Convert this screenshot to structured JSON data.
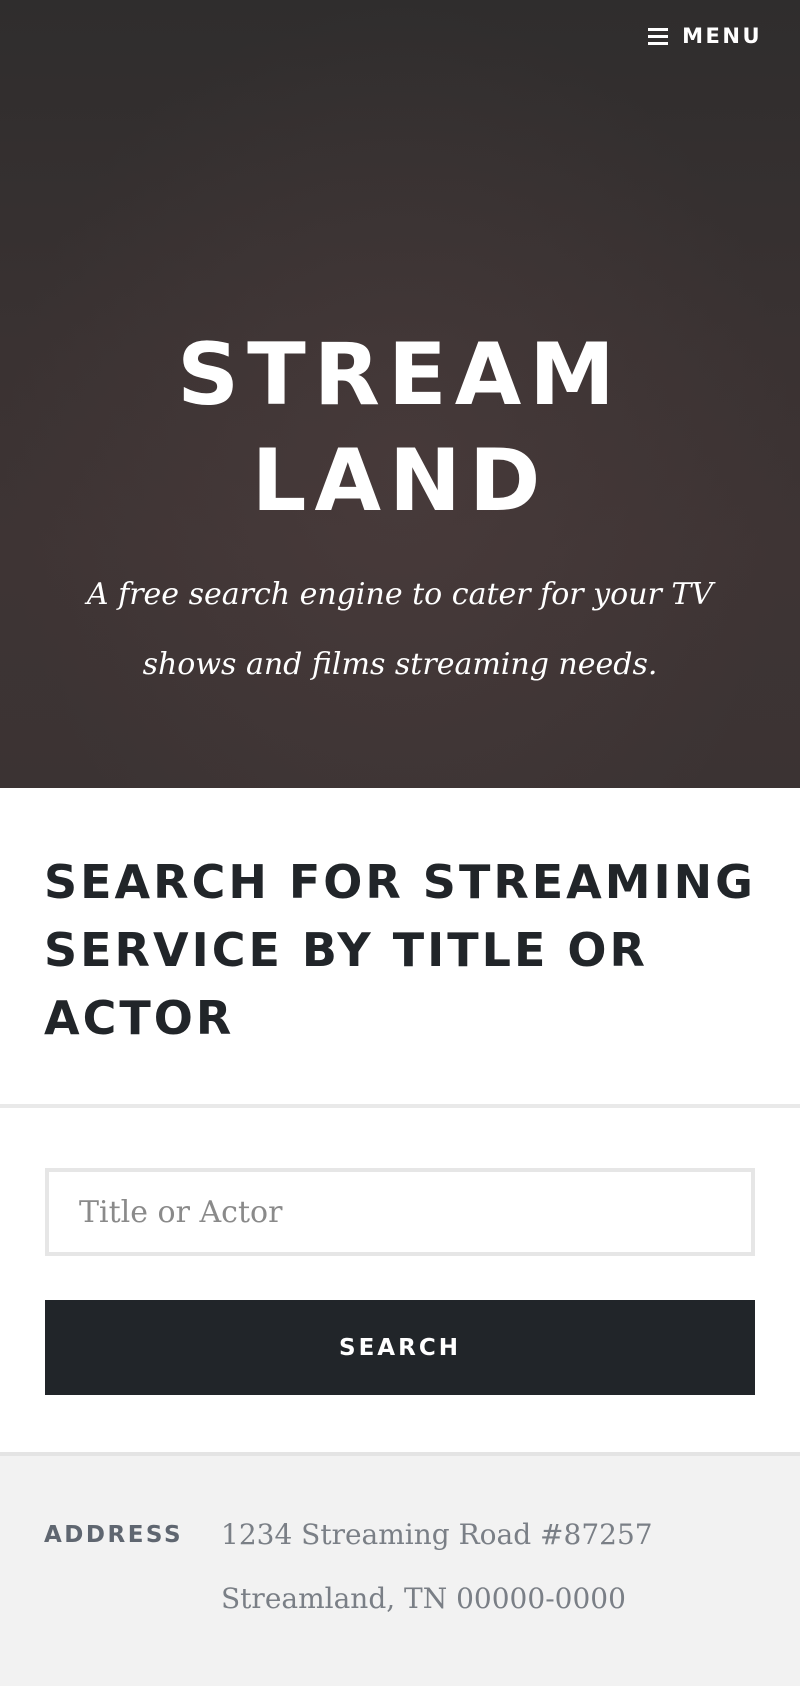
{
  "header": {
    "menu_label": "MENU",
    "menu_icon": "hamburger-icon",
    "site_title_line1": "STREAM",
    "site_title_line2": "LAND",
    "tagline": "A free search engine to cater for your TV shows and films streaming needs."
  },
  "search": {
    "heading": "SEARCH FOR STREAMING SERVICE BY TITLE OR ACTOR",
    "input_placeholder": "Title or Actor",
    "input_value": "",
    "button_label": "SEARCH"
  },
  "footer": {
    "address_label": "ADDRESS",
    "address_line1": "1234 Streaming Road #87257",
    "address_line2": "Streamland, TN 00000-0000"
  },
  "colors": {
    "hero_background": "#3a3232",
    "heading_text": "#212529",
    "button_background": "#212529",
    "footer_background": "#f2f2f2"
  }
}
